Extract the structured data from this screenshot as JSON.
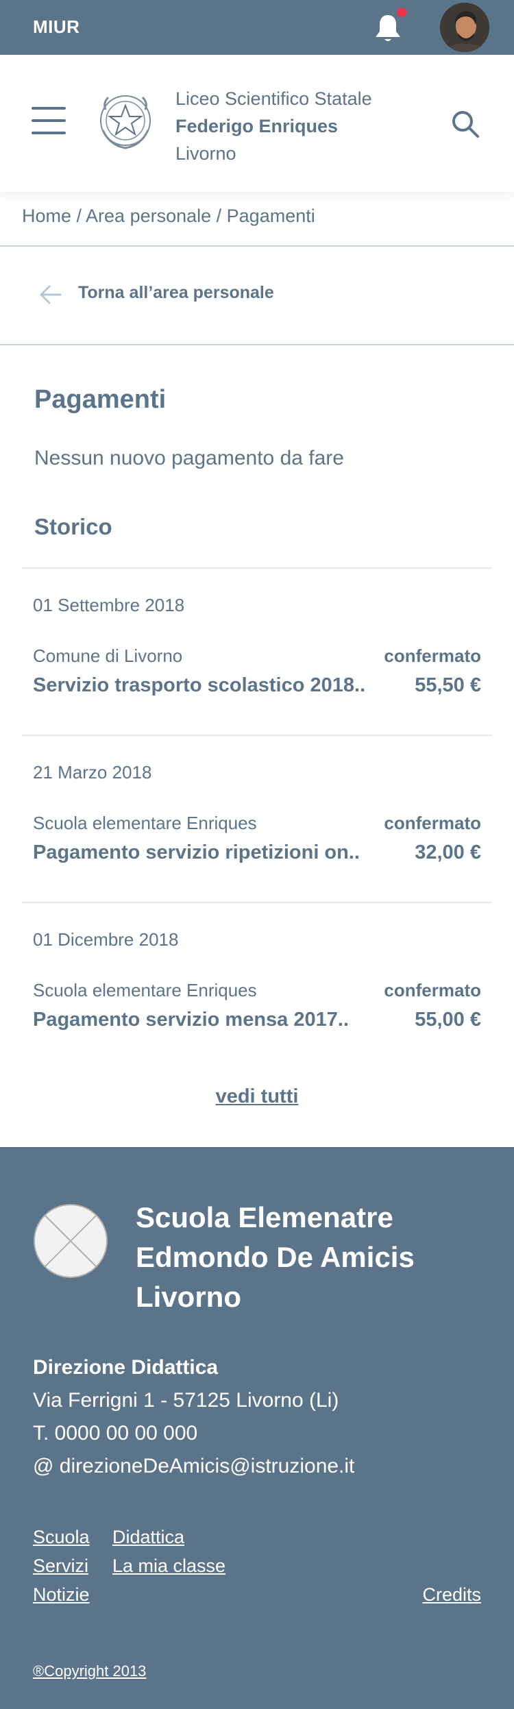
{
  "topbar": {
    "brand": "MIUR",
    "has_notification": true
  },
  "header": {
    "school_line1": "Liceo Scientifico Statale",
    "school_line2": "Federigo Enriques",
    "school_line3": "Livorno"
  },
  "breadcrumb": "Home / Area personale / Pagamenti",
  "back_link": "Torna all’area personale",
  "page_title": "Pagamenti",
  "empty_message": "Nessun nuovo pagamento da fare",
  "history_title": "Storico",
  "payments": [
    {
      "date": "01 Settembre 2018",
      "payee": "Comune di Livorno",
      "status": "confermato",
      "description": "Servizio trasporto scolastico 2018..",
      "amount": "55,50 €"
    },
    {
      "date": "21 Marzo 2018",
      "payee": "Scuola elementare Enriques",
      "status": "confermato",
      "description": "Pagamento servizio ripetizioni on..",
      "amount": "32,00 €"
    },
    {
      "date": "01 Dicembre 2018",
      "payee": "Scuola elementare Enriques",
      "status": "confermato",
      "description": "Pagamento servizio mensa 2017..",
      "amount": "55,00 €"
    }
  ],
  "see_all": "vedi tutti",
  "footer": {
    "name_line1": "Scuola Elemenatre",
    "name_line2": "Edmondo De Amicis",
    "name_line3": "Livorno",
    "office": "Direzione Didattica",
    "address": "Via Ferrigni 1 - 57125 Livorno (Li)",
    "phone": "T. 0000 00 00 000",
    "email": "@ direzioneDeAmicis@istruzione.it",
    "links": [
      "Scuola",
      "Didattica",
      "Servizi",
      "La mia classe",
      "Notizie",
      "Credits"
    ],
    "copyright": "®Copyright 2013"
  },
  "colors": {
    "primary": "#5c7489",
    "notification": "#e8354a",
    "divider": "#c5d3df",
    "background": "#ffffff"
  },
  "icons": [
    "bell-icon",
    "user-avatar",
    "hamburger-menu-icon",
    "republic-emblem-logo",
    "search-icon",
    "arrow-left-icon",
    "placeholder-logo"
  ]
}
